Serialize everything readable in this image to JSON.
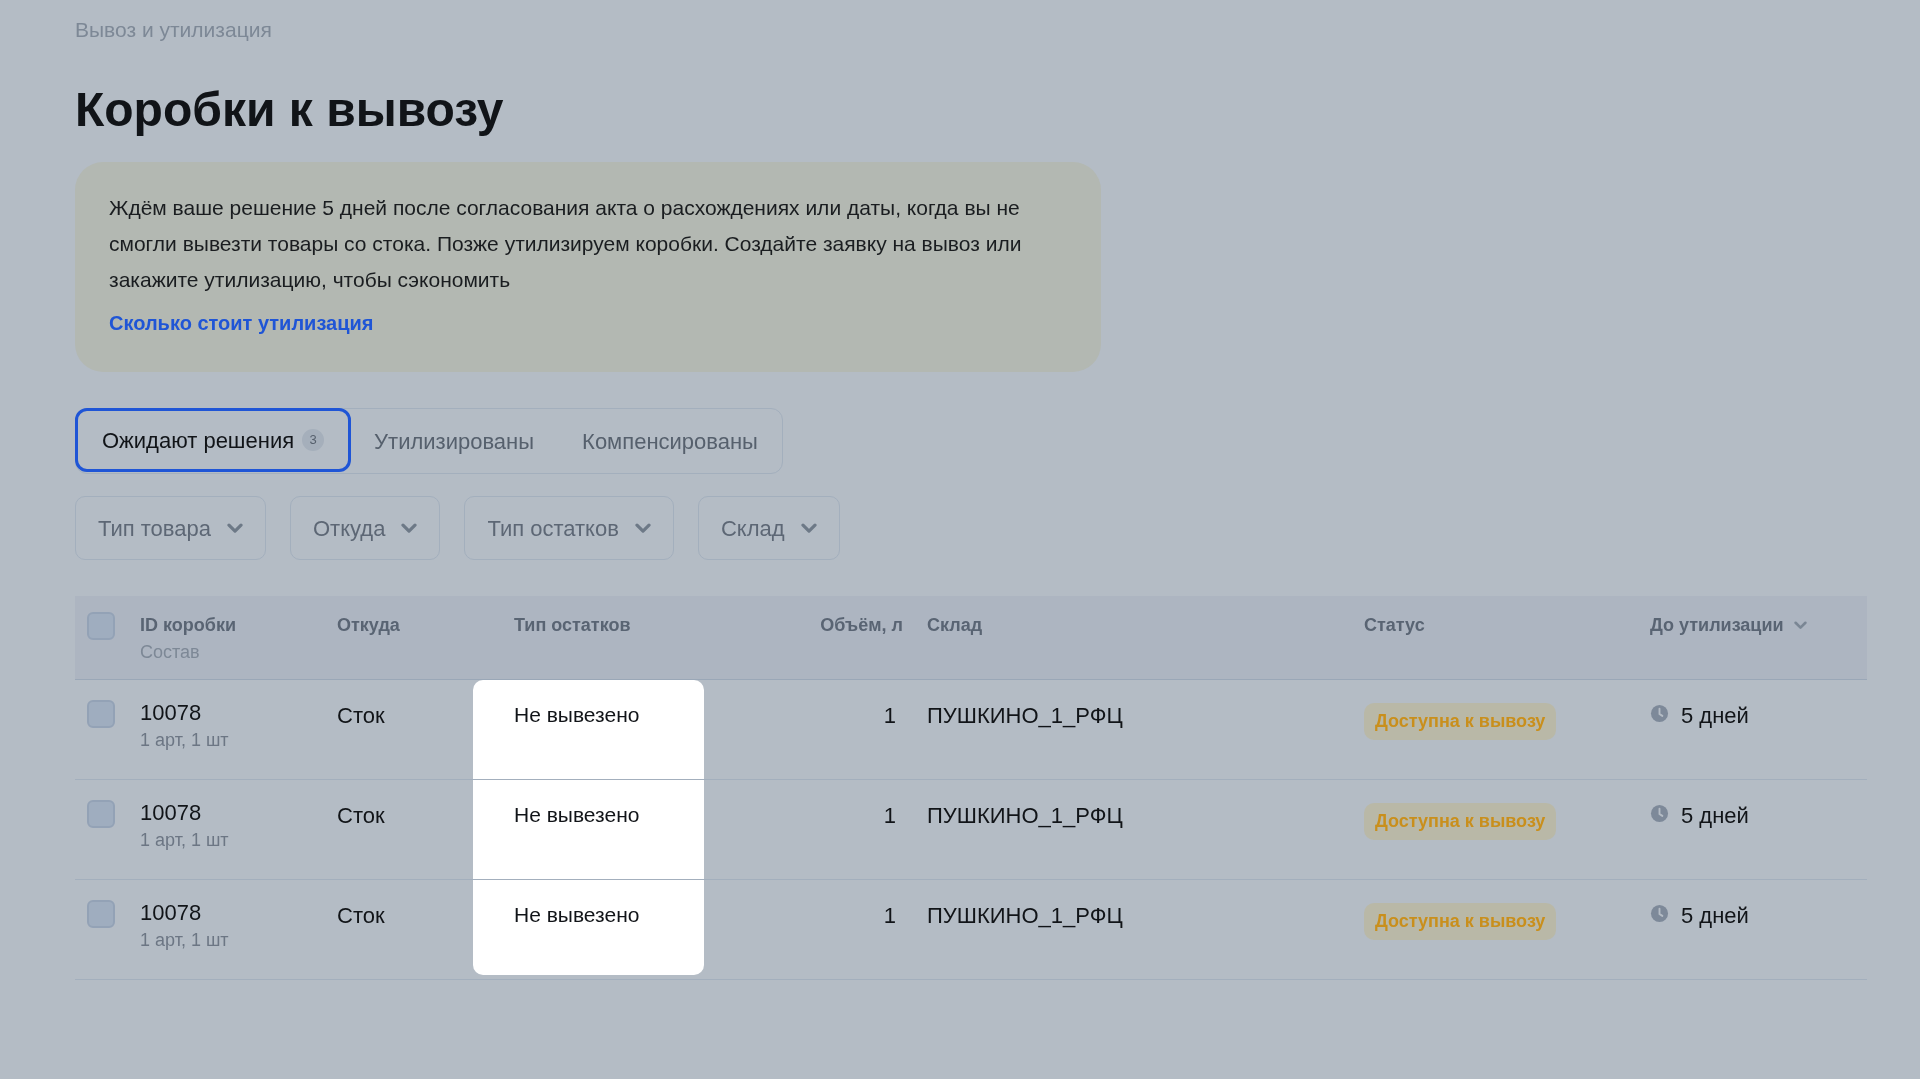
{
  "breadcrumb": "Вывоз и утилизация",
  "title": "Коробки к вывозу",
  "notice": {
    "text": "Ждём ваше решение 5 дней после согласования акта о расхождениях или даты, когда вы не смогли вывезти товары со стока. Позже утилизируем коробки. Создайте заявку на вывоз или закажите утилизацию, чтобы сэкономить",
    "link": "Сколько стоит утилизация"
  },
  "tabs": [
    {
      "label": "Ожидают решения",
      "count": "3",
      "selected": true
    },
    {
      "label": "Утилизированы",
      "selected": false
    },
    {
      "label": "Компенсированы",
      "selected": false
    }
  ],
  "filters": [
    "Тип товара",
    "Откуда",
    "Тип остатков",
    "Склад"
  ],
  "table": {
    "select_all_checked": false,
    "columns": [
      {
        "label": "ID коробки",
        "sublabel": "Состав"
      },
      {
        "label": "Откуда"
      },
      {
        "label": "Тип остатков"
      },
      {
        "label": "Объём, л"
      },
      {
        "label": "Склад"
      },
      {
        "label": "Статус"
      },
      {
        "label": "До утилизации",
        "sortable": true
      }
    ],
    "rows": [
      {
        "checked": false,
        "id": "10078",
        "composition": "1 арт, 1 шт",
        "from": "Сток",
        "remainder_type": "Не вывезено",
        "volume": "1",
        "warehouse": "ПУШКИНО_1_РФЦ",
        "status": "Доступна к вывозу",
        "until_disposal": "5 дней"
      },
      {
        "checked": false,
        "id": "10078",
        "composition": "1 арт, 1 шт",
        "from": "Сток",
        "remainder_type": "Не вывезено",
        "volume": "1",
        "warehouse": "ПУШКИНО_1_РФЦ",
        "status": "Доступна к вывозу",
        "until_disposal": "5 дней"
      },
      {
        "checked": false,
        "id": "10078",
        "composition": "1 арт, 1 шт",
        "from": "Сток",
        "remainder_type": "Не вывезено",
        "volume": "1",
        "warehouse": "ПУШКИНО_1_РФЦ",
        "status": "Доступна к вывозу",
        "until_disposal": "5 дней"
      }
    ]
  }
}
